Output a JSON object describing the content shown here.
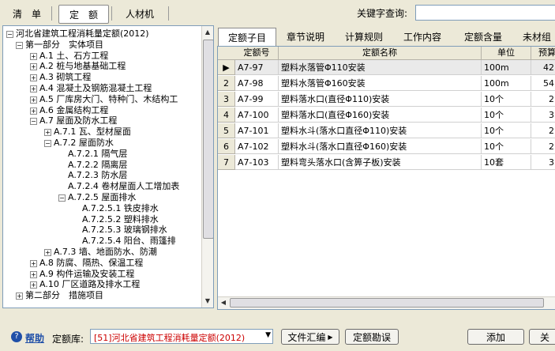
{
  "top_tabs": [
    "清　单",
    "定　额",
    "人材机"
  ],
  "search": {
    "label": "关键字查询:",
    "value": ""
  },
  "tree": [
    {
      "label": "河北省建筑工程消耗量定额(2012)",
      "level": 0,
      "exp": "-"
    },
    {
      "label": "第一部分　实体项目",
      "level": 1,
      "exp": "-"
    },
    {
      "label": "A.1 土、石方工程",
      "level": 2,
      "exp": "+"
    },
    {
      "label": "A.2 桩与地基基础工程",
      "level": 2,
      "exp": "+"
    },
    {
      "label": "A.3 砌筑工程",
      "level": 2,
      "exp": "+"
    },
    {
      "label": "A.4 混凝土及钢筋混凝土工程",
      "level": 2,
      "exp": "+"
    },
    {
      "label": "A.5 厂库房大门、特种门、木结构工",
      "level": 2,
      "exp": "+"
    },
    {
      "label": "A.6 金属结构工程",
      "level": 2,
      "exp": "+"
    },
    {
      "label": "A.7 屋面及防水工程",
      "level": 2,
      "exp": "-"
    },
    {
      "label": "A.7.1 瓦、型材屋面",
      "level": 3,
      "exp": "+"
    },
    {
      "label": "A.7.2 屋面防水",
      "level": 3,
      "exp": "-"
    },
    {
      "label": "A.7.2.1 隔气层",
      "level": 4,
      "exp": ""
    },
    {
      "label": "A.7.2.2 隔离层",
      "level": 4,
      "exp": ""
    },
    {
      "label": "A.7.2.3 防水层",
      "level": 4,
      "exp": ""
    },
    {
      "label": "A.7.2.4 卷材屋面人工增加表",
      "level": 4,
      "exp": ""
    },
    {
      "label": "A.7.2.5 屋面排水",
      "level": 4,
      "exp": "-"
    },
    {
      "label": "A.7.2.5.1 铁皮排水",
      "level": 5,
      "exp": ""
    },
    {
      "label": "A.7.2.5.2 塑料排水",
      "level": 5,
      "exp": ""
    },
    {
      "label": "A.7.2.5.3 玻璃钢排水",
      "level": 5,
      "exp": ""
    },
    {
      "label": "A.7.2.5.4 阳台、雨篷排",
      "level": 5,
      "exp": ""
    },
    {
      "label": "A.7.3 墙、地面防水、防潮",
      "level": 3,
      "exp": "+"
    },
    {
      "label": "A.8 防腐、隔热、保温工程",
      "level": 2,
      "exp": "+"
    },
    {
      "label": "A.9 构件运输及安装工程",
      "level": 2,
      "exp": "+"
    },
    {
      "label": "A.10 厂区道路及排水工程",
      "level": 2,
      "exp": "+"
    },
    {
      "label": "第二部分　措施项目",
      "level": 1,
      "exp": "+"
    }
  ],
  "right_tabs": [
    "定额子目",
    "章节说明",
    "计算规则",
    "工作内容",
    "定额含量",
    "未材组"
  ],
  "grid": {
    "headers": [
      "定额号",
      "定额名称",
      "单位",
      "预算"
    ],
    "rows": [
      {
        "num": "▶",
        "code": "A7-97",
        "name": "塑料水落管Φ110安装",
        "unit": "100m",
        "price": "42"
      },
      {
        "num": "2",
        "code": "A7-98",
        "name": "塑料水落管Φ160安装",
        "unit": "100m",
        "price": "54"
      },
      {
        "num": "3",
        "code": "A7-99",
        "name": "塑料落水口(直径Φ110)安装",
        "unit": "10个",
        "price": "2"
      },
      {
        "num": "4",
        "code": "A7-100",
        "name": "塑料落水口(直径Φ160)安装",
        "unit": "10个",
        "price": "3"
      },
      {
        "num": "5",
        "code": "A7-101",
        "name": "塑料水斗(落水口直径Φ110)安装",
        "unit": "10个",
        "price": "2"
      },
      {
        "num": "6",
        "code": "A7-102",
        "name": "塑料水斗(落水口直径Φ160)安装",
        "unit": "10个",
        "price": "2"
      },
      {
        "num": "7",
        "code": "A7-103",
        "name": "塑料弯头落水口(含箅子板)安装",
        "unit": "10套",
        "price": "3"
      }
    ]
  },
  "bottom": {
    "help": "帮助",
    "lib_label": "定额库:",
    "lib_value": "[51]河北省建筑工程消耗量定额(2012)",
    "btn_file": "文件汇编",
    "btn_survey": "定额勘误",
    "btn_add": "添加",
    "btn_close": "关"
  },
  "colors": {
    "accent": "#1f4fa8",
    "lib_text": "#cc0000"
  }
}
